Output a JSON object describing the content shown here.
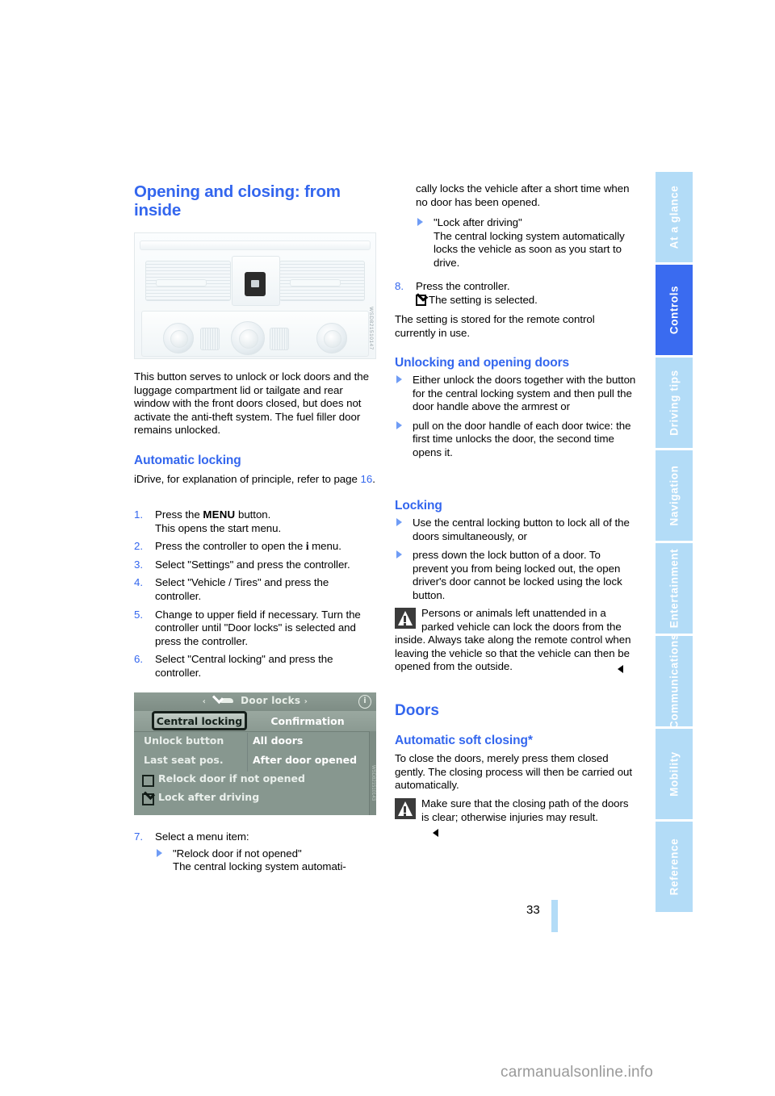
{
  "page": {
    "number": "33",
    "watermark": "carmanualsonline.info"
  },
  "colors": {
    "heading_blue": "#3366ee",
    "tab_active": "#3a6bf0",
    "tab_inactive": "#b3dcf7",
    "idrive_bg": "#87978f"
  },
  "tabs": [
    {
      "label": "At a glance",
      "active": false
    },
    {
      "label": "Controls",
      "active": true
    },
    {
      "label": "Driving tips",
      "active": false
    },
    {
      "label": "Navigation",
      "active": false
    },
    {
      "label": "Entertainment",
      "active": false
    },
    {
      "label": "Communications",
      "active": false
    },
    {
      "label": "Mobility",
      "active": false
    },
    {
      "label": "Reference",
      "active": false
    }
  ],
  "left": {
    "title": "Opening and closing: from inside",
    "photo_code": "WSD821510147",
    "intro": "This button serves to unlock or lock doors and the luggage compartment lid or tailgate and rear window with the front doors closed, but does not activate the anti-theft system. The fuel filler door remains unlocked.",
    "section_automatic_locking": "Automatic locking",
    "idrive_ref_pre": "iDrive, for explanation of principle, refer to page ",
    "idrive_ref_page": "16",
    "idrive_ref_post": ".",
    "steps": [
      {
        "num": "1.",
        "text_pre": "Press the ",
        "bold": "MENU",
        "text_post": " button.",
        "line2": "This opens the start menu."
      },
      {
        "num": "2.",
        "text_pre": "Press the controller to open the ",
        "bold": "i",
        "text_post": " menu.",
        "line2": ""
      },
      {
        "num": "3.",
        "text_pre": "Select \"Settings\" and press the controller.",
        "bold": "",
        "text_post": "",
        "line2": ""
      },
      {
        "num": "4.",
        "text_pre": "Select \"Vehicle / Tires\" and press the controller.",
        "bold": "",
        "text_post": "",
        "line2": ""
      },
      {
        "num": "5.",
        "text_pre": "Change to upper field if necessary. Turn the controller until \"Door locks\" is selected and press the controller.",
        "bold": "",
        "text_post": "",
        "line2": ""
      },
      {
        "num": "6.",
        "text_pre": "Select \"Central locking\" and press the controller.",
        "bold": "",
        "text_post": "",
        "line2": ""
      }
    ],
    "step7": {
      "num": "7.",
      "text": "Select a menu item:",
      "bullet_title": "\"Relock door if not opened\"",
      "bullet_body": "The central locking system automati-"
    }
  },
  "idrive_screen": {
    "title": "Door locks",
    "left_arrow": "‹",
    "right_arrow": "›",
    "info_icon": "i",
    "tab_selected": "Central locking",
    "tab_other": "Confirmation",
    "rows": [
      {
        "label": "Unlock button",
        "value": "All doors"
      },
      {
        "label": "Last seat pos.",
        "value": "After door opened"
      }
    ],
    "checkboxes": [
      {
        "label": "Relock door if not opened",
        "checked": false
      },
      {
        "label": "Lock after driving",
        "checked": true
      }
    ],
    "code": "WSD821510143"
  },
  "right": {
    "cont_text": "cally locks the vehicle after a short time when no door has been opened.",
    "bullet_lock_title": "\"Lock after driving\"",
    "bullet_lock_body": "The central locking system automatically locks the vehicle as soon as you start to drive.",
    "step8": {
      "num": "8.",
      "text": "Press the controller.",
      "result": "The setting is selected."
    },
    "stored_note": "The setting is stored for the remote control currently in use.",
    "section_unlocking": "Unlocking and opening doors",
    "unlock_bullets": [
      "Either unlock the doors together with the button for the central locking system and then pull the door handle above the armrest or",
      "pull on the door handle of each door twice: the first time unlocks the door, the second time opens it."
    ],
    "section_locking": "Locking",
    "locking_bullets": [
      "Use the central locking button to lock all of the doors simultaneously, or",
      "press down the lock button of a door. To prevent you from being locked out, the open driver's door cannot be locked using the lock button."
    ],
    "warning_locking": "Persons or animals left unattended in a parked vehicle can lock the doors from the inside. Always take along the remote control when leaving the vehicle so that the vehicle can then be opened from the outside.",
    "section_doors": "Doors",
    "section_soft_closing": "Automatic soft closing*",
    "soft_closing_body": "To close the doors, merely press them closed gently. The closing process will then be carried out automatically.",
    "warning_soft_closing": "Make sure that the closing path of the doors is clear; otherwise injuries may result."
  }
}
